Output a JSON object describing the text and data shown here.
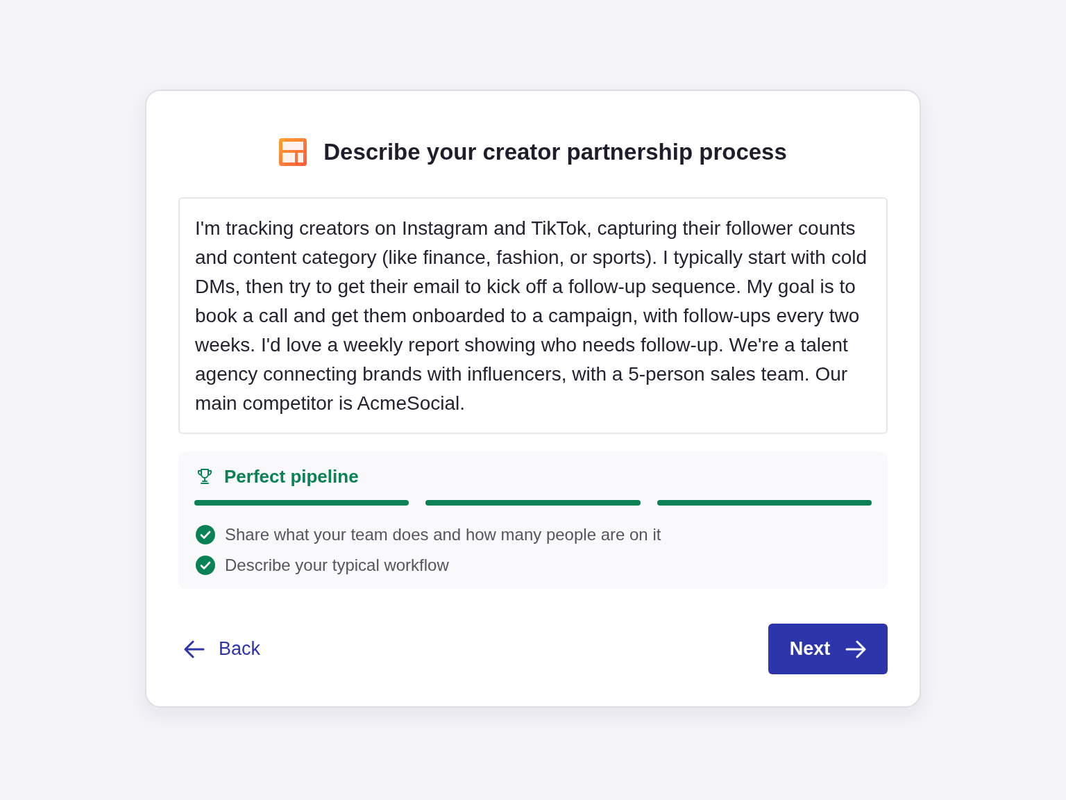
{
  "header": {
    "title": "Describe your creator partnership process"
  },
  "description": {
    "value": "I'm tracking creators on Instagram and TikTok, capturing their follower counts and content category (like finance, fashion, or sports). I typically start with cold DMs, then try to get their email to kick off a follow-up sequence. My goal is to book a call and get them onboarded to a campaign, with follow-ups every two weeks. I'd love a weekly report showing who needs follow-up. We're a talent agency connecting brands with influencers, with a 5-person sales team. Our main competitor is AcmeSocial."
  },
  "feedback": {
    "title": "Perfect pipeline",
    "segments": [
      {
        "filled": true
      },
      {
        "filled": true
      },
      {
        "filled": true
      }
    ],
    "checklist": [
      {
        "text": "Share what your team does and how many people are on it",
        "done": true
      },
      {
        "text": "Describe your typical workflow",
        "done": true
      }
    ]
  },
  "buttons": {
    "back": "Back",
    "next": "Next"
  }
}
